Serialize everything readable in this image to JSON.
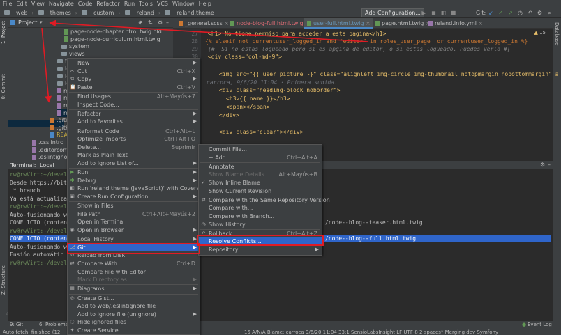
{
  "menubar": [
    "File",
    "Edit",
    "View",
    "Navigate",
    "Code",
    "Refactor",
    "Run",
    "Tools",
    "VCS",
    "Window",
    "Help"
  ],
  "breadcrumb": [
    "web",
    "themes",
    "custom",
    "reland",
    "reland.theme"
  ],
  "toolbar": {
    "add_config": "Add Configuration...",
    "git_label": "Git:"
  },
  "project_panel": {
    "title": "Project",
    "items": [
      {
        "label": "page-node-chapter.html.twig.old",
        "kind": "tw"
      },
      {
        "label": "page-node-curriculum.html.twig",
        "kind": "tw"
      },
      {
        "label": "system",
        "kind": "folder"
      },
      {
        "label": "views",
        "kind": "folder"
      },
      {
        "label": "fav",
        "kind": "folder"
      },
      {
        "label": "log",
        "kind": "folder"
      },
      {
        "label": "log",
        "kind": "folder"
      },
      {
        "label": "log",
        "kind": "folder"
      },
      {
        "label": "rela",
        "kind": "file"
      },
      {
        "label": "rela",
        "kind": "file"
      },
      {
        "label": "rela",
        "kind": "file"
      },
      {
        "label": "rela",
        "kind": "file"
      },
      {
        "label": ".gitignore",
        "kind": "git"
      },
      {
        "label": ".gitkeep",
        "kind": "git"
      },
      {
        "label": "README",
        "kind": "md"
      },
      {
        "label": ".csslintrc",
        "kind": "file"
      },
      {
        "label": ".editorconfig",
        "kind": "file"
      },
      {
        "label": ".eslintignore",
        "kind": "file"
      },
      {
        "label": ".eslintrc.json",
        "kind": "file"
      }
    ]
  },
  "editor_tabs": [
    {
      "label": "_general.scss"
    },
    {
      "label": "node-blog-full.html.twig"
    },
    {
      "label": "user-full.html.twig"
    },
    {
      "label": "page.html.twig"
    },
    {
      "label": "reland.info.yml"
    }
  ],
  "editor": {
    "line_numbers": [
      "27",
      "28",
      "29",
      "30",
      "31",
      "32"
    ],
    "inspection": "15",
    "lines": [
      "<h1> No tiene permiso para acceder a esta pagina</h1>",
      "{% elseif not currentuser_logged_in and \"editor\" in roles_user_page  or currentuser_logged_in %}",
      "{#  Si no estas logueado pero si es apgina de editor, o si estas logueado. Puedes verlo #}",
      "<div class=\"col-md-9\">",
      "<img src=\"{{ user_picture }}\" class=\"alignleft img-circle img-thumbnail notopmargin nobottommargin\" a",
      "carroca, 9/6/20 11:04 · Primera subida.",
      "<div class=\"heading-block noborder\">",
      "<h3>{{ name }}</h3>",
      "<span></span>",
      "</div>",
      "<div class=\"clear\"></div>"
    ]
  },
  "terminal": {
    "title": "Terminal:",
    "tab": "Local",
    "lines": [
      "rw@rwVirt:~/devel",
      "Desde https://bit",
      " * branch",
      "Ya está actualiza",
      "rw@rwVirt:~/devel",
      "Auto-fusionando w",
      "CONFLICTO (conten",
      "rw@rwVirt:~/devel",
      "CONFLICTO (conten",
      "Auto-fusionando w",
      "Fusión automátic",
      "rw@rwVirt:~/devel"
    ],
    "right_lines": [
      "/node--blog--teaser.html.twig",
      "/node--blog--full.html.twig",
      "atice un commit con el resultado."
    ]
  },
  "context_menu": {
    "items": [
      {
        "label": "New",
        "shortcut": "",
        "submenu": true
      },
      {
        "label": "Cut",
        "shortcut": "Ctrl+X"
      },
      {
        "label": "Copy",
        "shortcut": "",
        "submenu": true
      },
      {
        "label": "Paste",
        "shortcut": "Ctrl+V"
      },
      {
        "label": "Find Usages",
        "shortcut": "Alt+Mayús+7"
      },
      {
        "label": "Inspect Code..."
      },
      {
        "label": "Refactor",
        "submenu": true
      },
      {
        "label": "Add to Favorites",
        "submenu": true
      },
      {
        "label": "Reformat Code",
        "shortcut": "Ctrl+Alt+L"
      },
      {
        "label": "Optimize Imports",
        "shortcut": "Ctrl+Alt+O"
      },
      {
        "label": "Delete...",
        "shortcut": "Suprimir"
      },
      {
        "label": "Mark as Plain Text"
      },
      {
        "label": "Add to Ignore List of...",
        "submenu": true
      },
      {
        "label": "Run",
        "submenu": true
      },
      {
        "label": "Debug",
        "submenu": true
      },
      {
        "label": "Run 'reland.theme (JavaScript)' with Coverage"
      },
      {
        "label": "Create Run Configuration",
        "submenu": true
      },
      {
        "label": "Show in Files"
      },
      {
        "label": "File Path",
        "shortcut": "Ctrl+Alt+Mayús+2"
      },
      {
        "label": "Open in Terminal"
      },
      {
        "label": "Open in Browser",
        "submenu": true
      },
      {
        "label": "Local History",
        "submenu": true
      },
      {
        "label": "Git",
        "submenu": true
      },
      {
        "label": "Reload from Disk"
      },
      {
        "label": "Compare With...",
        "shortcut": "Ctrl+D"
      },
      {
        "label": "Compare File with Editor"
      },
      {
        "label": "Mark Directory as",
        "submenu": true
      },
      {
        "label": "Diagrams",
        "submenu": true
      },
      {
        "label": "Create Gist..."
      },
      {
        "label": "Add to web/.eslintignore file"
      },
      {
        "label": "Add to ignore file (unignore)",
        "submenu": true
      },
      {
        "label": "Hide ignored files"
      },
      {
        "label": "Create Service"
      }
    ]
  },
  "git_submenu": {
    "items": [
      {
        "label": "Commit File..."
      },
      {
        "label": "+ Add",
        "shortcut": "Ctrl+Alt+A"
      },
      {
        "label": "Annotate"
      },
      {
        "label": "Show Blame Details",
        "shortcut": "Alt+Mayús+B"
      },
      {
        "label": "Show Inline Blame"
      },
      {
        "label": "Show Current Revision"
      },
      {
        "label": "Compare with the Same Repository Version"
      },
      {
        "label": "Compare with..."
      },
      {
        "label": "Compare with Branch..."
      },
      {
        "label": "Show History"
      },
      {
        "label": "Rollback...",
        "shortcut": "Ctrl+Alt+Z"
      },
      {
        "label": "Resolve Conflicts..."
      },
      {
        "label": "Repository",
        "submenu": true
      }
    ]
  },
  "bottom_tabs": [
    "9: Git",
    "6: Problems",
    "Event Log"
  ],
  "statusbar": {
    "left": "Auto fetch: finished (12",
    "right": "15 A/N/A  Blame: carroca 9/6/20 11:04  33:1  SensioLabsInsight  LF  UTF-8  2 spaces*  Merging dev  Symfony"
  },
  "colors": {
    "selection": "#2f65ca",
    "highlight_box": "#e01b24"
  }
}
